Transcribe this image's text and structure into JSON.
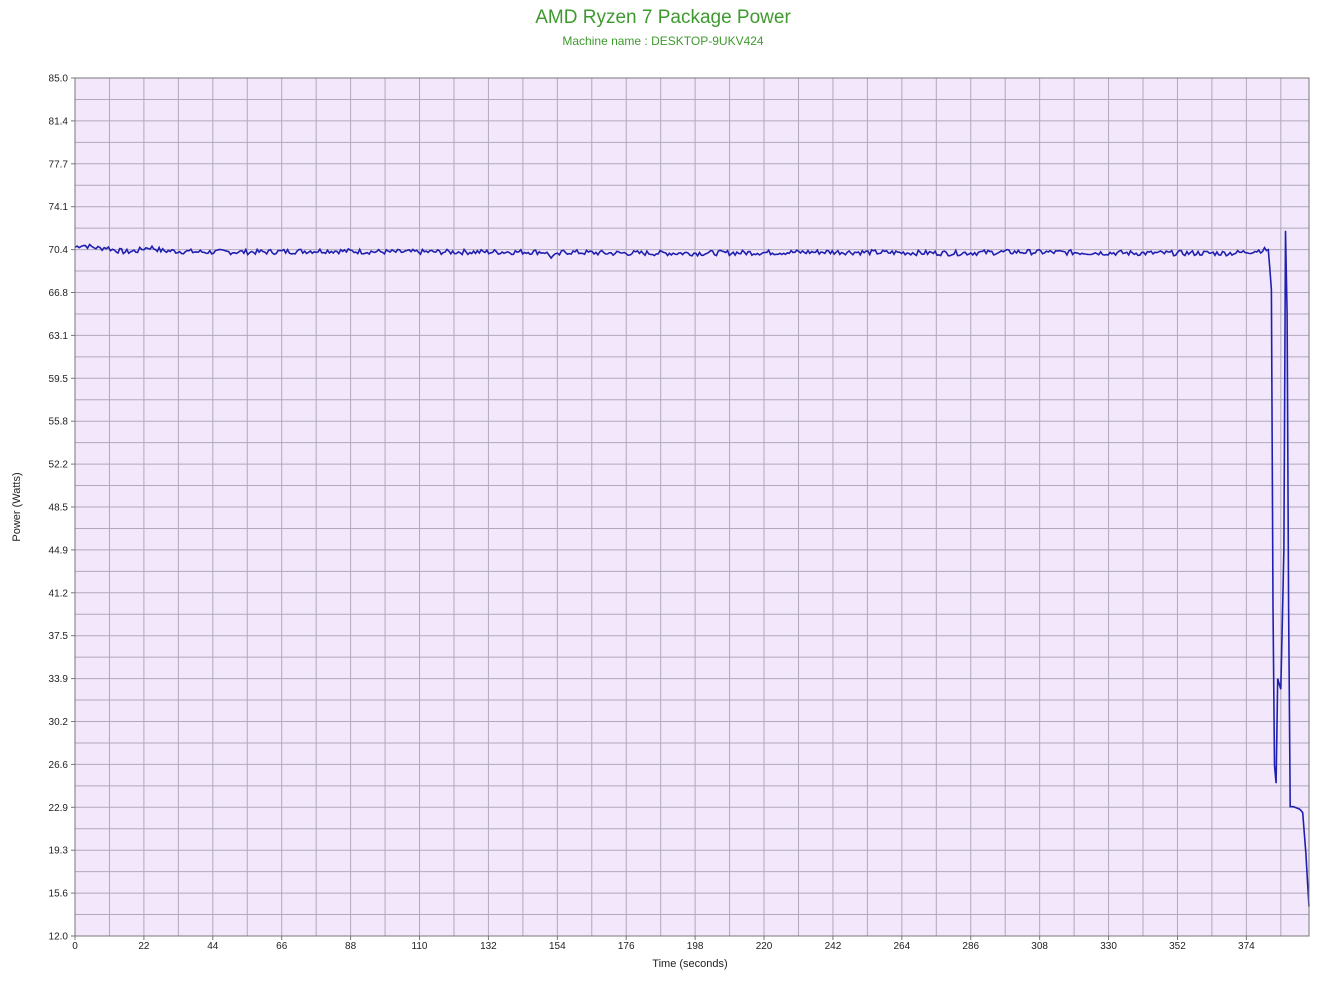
{
  "chart_data": {
    "type": "line",
    "title": "AMD Ryzen 7 Package Power",
    "subtitle": "Machine name : DESKTOP-9UKV424",
    "xlabel": "Time (seconds)",
    "ylabel": "Power (Watts)",
    "xlim": [
      0,
      394
    ],
    "ylim": [
      12.0,
      85.0
    ],
    "x_ticks": [
      "0",
      "22",
      "44",
      "66",
      "88",
      "110",
      "132",
      "154",
      "176",
      "198",
      "220",
      "242",
      "264",
      "286",
      "308",
      "330",
      "352",
      "374"
    ],
    "y_ticks": [
      "85.0",
      "81.4",
      "77.7",
      "74.1",
      "70.4",
      "66.8",
      "63.1",
      "59.5",
      "55.8",
      "52.2",
      "48.5",
      "44.9",
      "41.2",
      "37.5",
      "33.9",
      "30.2",
      "26.6",
      "22.9",
      "19.3",
      "15.6",
      "12.0"
    ],
    "grid": true,
    "colors": {
      "background": "#f3e8fb",
      "grid": "#b0a8bc",
      "line": "#2020b0",
      "title": "#3e9a2e"
    },
    "series": [
      {
        "x": [
          0,
          2,
          4,
          6,
          8,
          10,
          12,
          16,
          20,
          22,
          24,
          28,
          40,
          60,
          80,
          100,
          120,
          140,
          150,
          152,
          154,
          156,
          170,
          200,
          240,
          280,
          300,
          340,
          370,
          381,
          382,
          382.5,
          383,
          383.5,
          384,
          385,
          386,
          386.5,
          387,
          387.5,
          388,
          388.5,
          389,
          390,
          391,
          392,
          393,
          394
        ],
        "y": [
          70.6,
          70.8,
          70.7,
          70.6,
          70.5,
          70.6,
          70.4,
          70.2,
          70.3,
          70.5,
          70.6,
          70.3,
          70.2,
          70.2,
          70.3,
          70.2,
          70.2,
          70.2,
          70.2,
          69.8,
          69.9,
          70.2,
          70.1,
          70.1,
          70.2,
          70.1,
          70.2,
          70.1,
          70.1,
          70.4,
          67.0,
          40.0,
          26.5,
          25.0,
          33.9,
          33.0,
          45.0,
          72.0,
          65.0,
          40.0,
          23.0,
          23.0,
          23.0,
          22.9,
          22.8,
          22.5,
          19.0,
          14.5
        ]
      }
    ]
  }
}
